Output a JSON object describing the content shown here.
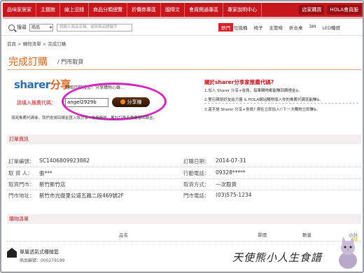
{
  "topnav": {
    "items": [
      "品味家居家",
      "主題館",
      "線上沒錢",
      "商品分類總覽",
      "折價券專區",
      "國際文",
      "會員開通專區",
      "專家說明中心"
    ],
    "right": [
      "店家購買",
      "HOLA會員服"
    ]
  },
  "search": {
    "label": "搜尋",
    "category": "商品",
    "placeholder": "請輸入商品名稱，或依商品關鍵字",
    "hot_tag": "熱門",
    "hot_words": [
      "垃圾桶",
      "椅子",
      "主管椅",
      "折合桌",
      "3M",
      "LED檯燈"
    ]
  },
  "breadcrumb": "首頁 > 購物清單 > 完成訂購",
  "page": {
    "title": "完成訂購",
    "subtitle": "/ 門市取貨"
  },
  "sharer": {
    "logo_en": "sharer",
    "logo_cn": "分享",
    "tagline": "賺取回饋禮金！分享購物心聲...",
    "ref_label": "請填入推薦代碼：",
    "ref_value": "angel2929b",
    "button_label": "分享賺",
    "note": "填寫推薦代碼後，我們會將回饋金匯入該分享+會員帳號，累計訂單不重覆發回饋金。"
  },
  "promo": {
    "title": "關於sharer分享家推薦代碼?",
    "lines": [
      "1.加入 Sharer 分享+會員，每筆購物都能賺回饋禮金$。",
      "2.雙召親朋好友給力量 & HOLA網站購物填入你的推薦代碼就能賺$。",
      "3.還不是 Sharer 分享+會員? 現在立即加入!!下一次購物立即賺$。"
    ]
  },
  "order": {
    "section_title": "訂單資訊",
    "order_no_label": "訂單編號：",
    "order_no": "SC1406809923882",
    "order_date_label": "訂購日期：",
    "order_date": "2014-07-31",
    "receiver_label": "取 貨 人：",
    "receiver": "張***",
    "phone_label": "行動電話：",
    "phone": "09328*****",
    "store_label": "取貨門市：",
    "store": "新竹新竹店",
    "method_label": "取貨方式：",
    "method": "一次取貨",
    "address_label": "門市地址：",
    "address": "新竹市光復里公道五路二段469號2F",
    "tel_label": "門市電話：",
    "tel": "(03)575-1234"
  },
  "cart": {
    "section_title": "購物清單",
    "col_name": "品名",
    "col_price": "單價",
    "col_qty": "數量",
    "col_subtotal": "小計",
    "item_name": "單層透氣式種植籃",
    "item_no": "商品編號：000279199"
  },
  "watermark": "天使熊小人生食譜"
}
